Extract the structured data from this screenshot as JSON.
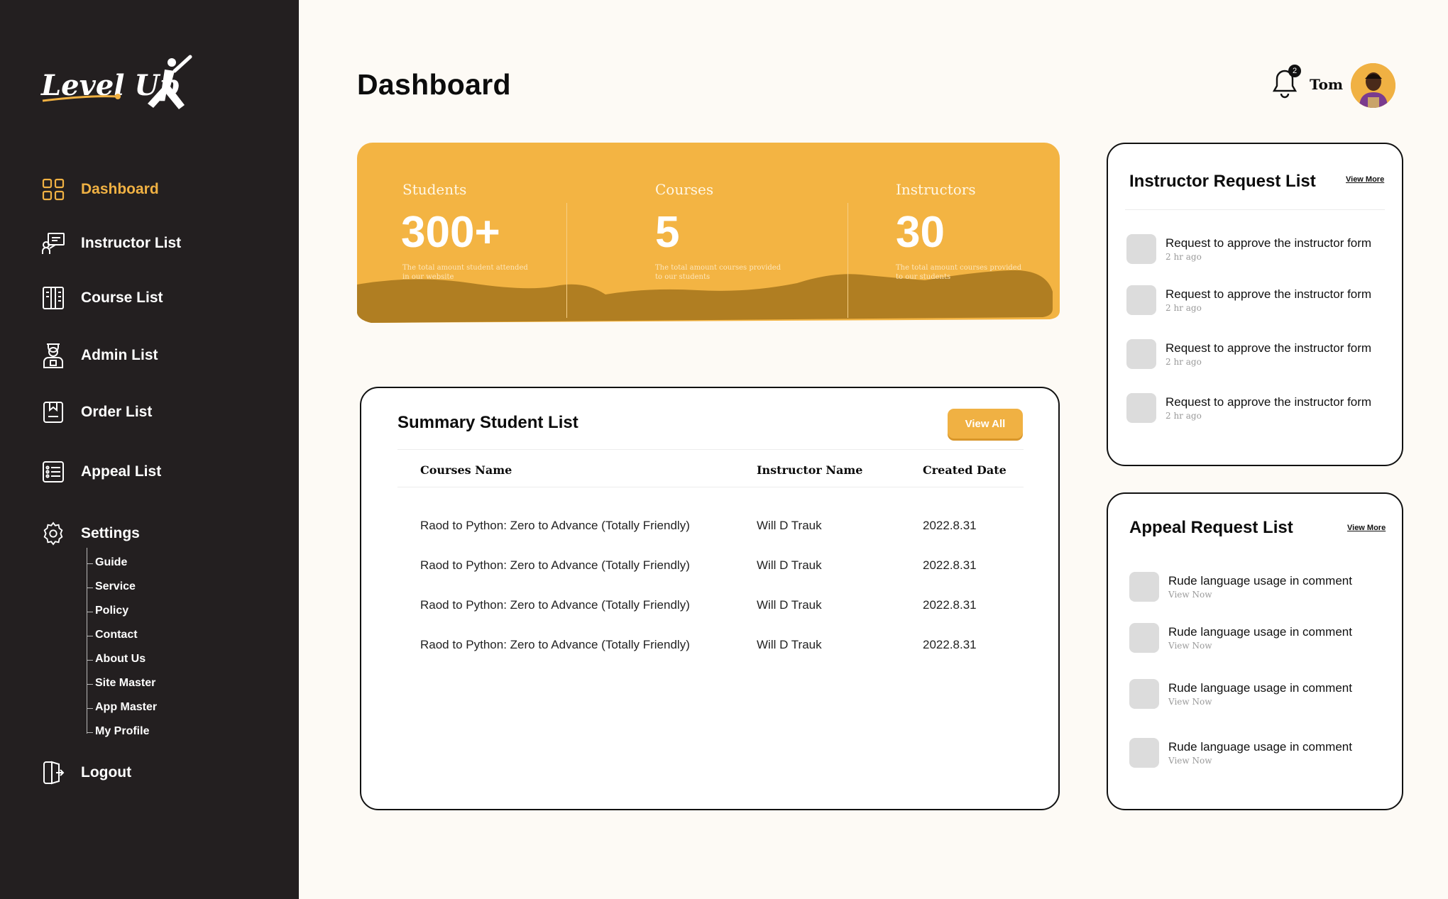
{
  "brand": {
    "logo_text": "Level Up"
  },
  "sidebar": {
    "items": [
      {
        "label": "Dashboard",
        "icon": "dashboard-grid-icon",
        "active": true
      },
      {
        "label": "Instructor List",
        "icon": "instructor-board-icon"
      },
      {
        "label": "Course List",
        "icon": "course-book-icon"
      },
      {
        "label": "Admin List",
        "icon": "admin-user-icon"
      },
      {
        "label": "Order List",
        "icon": "order-bookmark-icon"
      },
      {
        "label": "Appeal List",
        "icon": "appeal-list-icon"
      },
      {
        "label": "Settings",
        "icon": "gear-icon"
      }
    ],
    "settings_sub": [
      "Guide",
      "Service",
      "Policy",
      "Contact",
      "About Us",
      "Site Master",
      "App Master",
      "My Profile"
    ],
    "logout": {
      "label": "Logout",
      "icon": "logout-door-icon"
    }
  },
  "header": {
    "title": "Dashboard",
    "notification_count": "2",
    "user_name": "Tom"
  },
  "stats": [
    {
      "label": "Students",
      "value": "300+",
      "desc": "The total amount student attended in our website"
    },
    {
      "label": "Courses",
      "value": "5",
      "desc": "The total amount courses provided to our students"
    },
    {
      "label": "Instructors",
      "value": "30",
      "desc": "The total amount courses provided to our students"
    }
  ],
  "summary": {
    "title": "Summary Student  List",
    "view_all": "View All",
    "columns": [
      "Courses Name",
      "Instructor Name",
      "Created Date"
    ],
    "rows": [
      [
        "Raod to Python: Zero to Advance (Totally Friendly)",
        "Will D Trauk",
        "2022.8.31"
      ],
      [
        "Raod to Python: Zero to Advance (Totally Friendly)",
        "Will D Trauk",
        "2022.8.31"
      ],
      [
        "Raod to Python: Zero to Advance (Totally Friendly)",
        "Will D Trauk",
        "2022.8.31"
      ],
      [
        "Raod to Python: Zero to Advance (Totally Friendly)",
        "Will D Trauk",
        "2022.8.31"
      ]
    ]
  },
  "instructor_requests": {
    "title": "Instructor Request List",
    "view_more": "View More",
    "items": [
      {
        "title": "Request to approve the instructor form",
        "time": "2 hr ago"
      },
      {
        "title": "Request to approve the instructor form",
        "time": "2 hr ago"
      },
      {
        "title": "Request to approve the instructor form",
        "time": "2 hr ago"
      },
      {
        "title": "Request to approve the instructor form",
        "time": "2 hr ago"
      }
    ]
  },
  "appeal_requests": {
    "title": "Appeal Request List",
    "view_more": "View More",
    "items": [
      {
        "title": "Rude language usage in comment",
        "action": "View Now"
      },
      {
        "title": "Rude language usage in comment",
        "action": "View Now"
      },
      {
        "title": "Rude language usage in comment",
        "action": "View Now"
      },
      {
        "title": "Rude language usage in comment",
        "action": "View Now"
      }
    ]
  },
  "colors": {
    "sidebar": "#231f20",
    "accent": "#f0b143",
    "accent_dark": "#b07e22",
    "background": "#fdfaf5"
  }
}
